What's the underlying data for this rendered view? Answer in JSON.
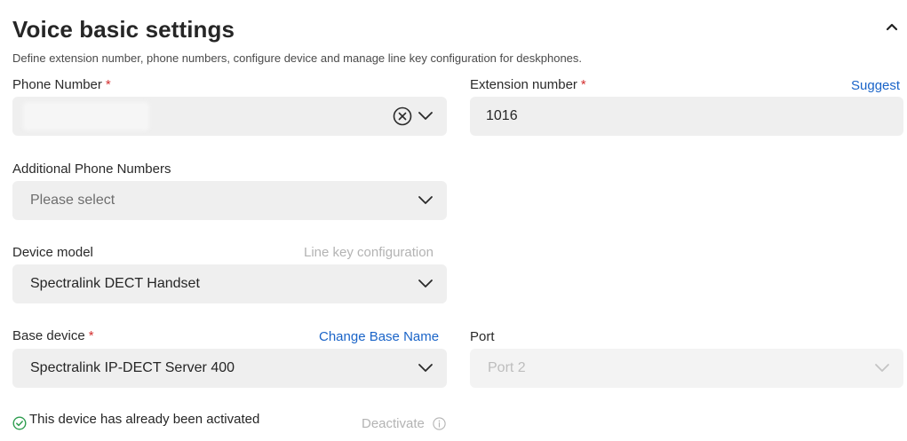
{
  "section": {
    "title": "Voice basic settings",
    "subtitle": "Define extension number, phone numbers, configure device and manage line key configuration for deskphones."
  },
  "phone_number": {
    "label": "Phone Number",
    "required_mark": "*",
    "value": ""
  },
  "extension_number": {
    "label": "Extension number",
    "required_mark": "*",
    "suggest_label": "Suggest",
    "value": "1016"
  },
  "additional_phone_numbers": {
    "label": "Additional Phone Numbers",
    "placeholder": "Please select"
  },
  "device_model": {
    "label": "Device model",
    "line_key_link": "Line key configuration",
    "value": "Spectralink DECT Handset"
  },
  "base_device": {
    "label": "Base device",
    "required_mark": "*",
    "change_link": "Change Base Name",
    "value": "Spectralink IP-DECT Server 400"
  },
  "port": {
    "label": "Port",
    "value": "Port 2"
  },
  "activation": {
    "status_text": "This device has already been activated",
    "deactivate_label": "Deactivate"
  },
  "colors": {
    "link": "#1a64c8",
    "required": "#d32f2f",
    "success": "#2e9d4f",
    "field_bg": "#efefef"
  },
  "icons": {
    "collapse": "chevron-up-icon",
    "dropdown": "chevron-down-icon",
    "clear": "clear-circle-icon",
    "status": "check-circle-icon",
    "info": "info-icon"
  }
}
